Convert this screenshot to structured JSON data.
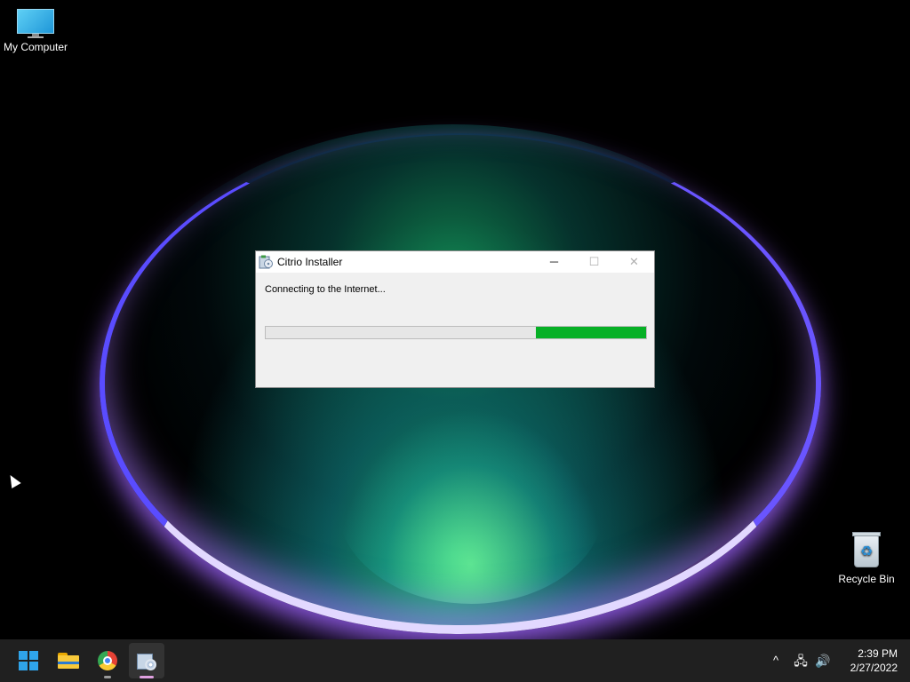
{
  "desktop": {
    "icons": [
      {
        "label": "My Computer",
        "icon": "monitor-icon"
      },
      {
        "label": "Recycle Bin",
        "icon": "recycle-bin-icon"
      }
    ]
  },
  "installer": {
    "title": "Citrio Installer",
    "status": "Connecting to the Internet...",
    "progress_range": [
      0.71,
      1.0
    ],
    "progress_color": "#06b025",
    "controls": {
      "minimize": "─",
      "maximize": "☐",
      "close": "✕"
    }
  },
  "taskbar": {
    "items": [
      {
        "name": "start",
        "icon": "windows-logo-icon"
      },
      {
        "name": "file-explorer",
        "icon": "folder-icon"
      },
      {
        "name": "chrome",
        "icon": "chrome-icon"
      },
      {
        "name": "citrio-installer",
        "icon": "installer-icon",
        "active": true
      }
    ],
    "tray": {
      "chevron": "^",
      "network": "🖧",
      "volume": "🔊"
    },
    "time": "2:39 PM",
    "date": "2/27/2022"
  },
  "colors": {
    "taskbar": "#202020",
    "window_bg": "#f0f0f0",
    "accent": "#2fa4ea"
  }
}
